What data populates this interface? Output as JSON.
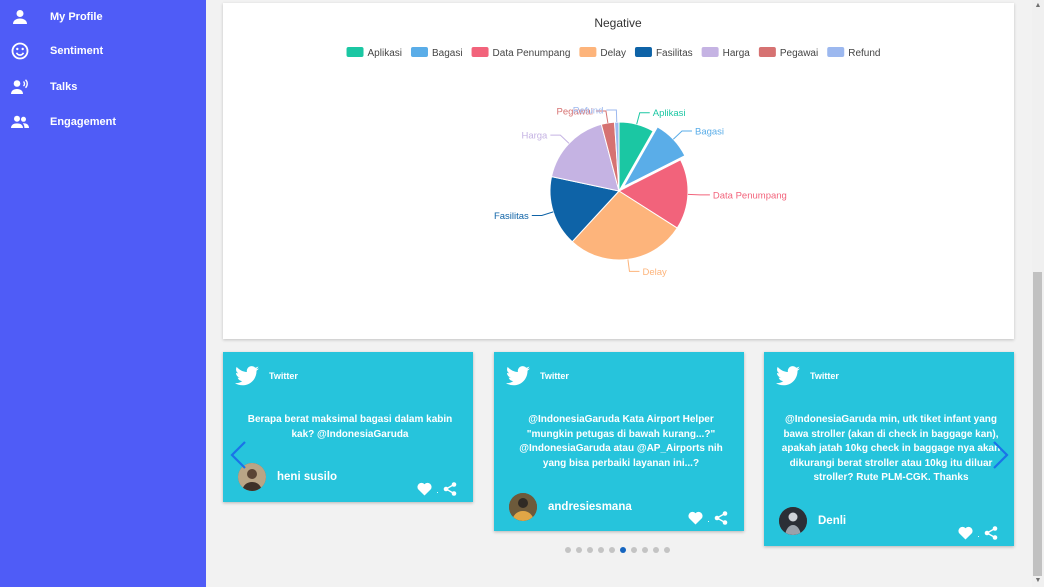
{
  "sidebar": {
    "items": [
      {
        "label": "My Profile",
        "icon": "person-icon"
      },
      {
        "label": "Sentiment",
        "icon": "smiley-icon"
      },
      {
        "label": "Talks",
        "icon": "talks-icon"
      },
      {
        "label": "Engagement",
        "icon": "group-icon"
      }
    ]
  },
  "chart_data": {
    "type": "pie",
    "title": "Negative",
    "legend_position": "top",
    "categories": [
      "Aplikasi",
      "Bagasi",
      "Data Penumpang",
      "Delay",
      "Fasilitas",
      "Harga",
      "Pegawai",
      "Refund"
    ],
    "values": [
      8,
      9,
      16,
      27,
      16,
      17,
      3,
      1
    ],
    "colors": [
      "#1bc7a3",
      "#5aade8",
      "#f2637b",
      "#fdb47b",
      "#0e63a7",
      "#c5b3e3",
      "#d67272",
      "#9cb8ef"
    ],
    "highlighted": "Bagasi"
  },
  "tweets": [
    {
      "source": "Twitter",
      "text": "Berapa berat maksimal bagasi dalam kabin kak? @IndonesiaGaruda",
      "user": "heni susilo"
    },
    {
      "source": "Twitter",
      "text": "@IndonesiaGaruda Kata Airport Helper \"mungkin petugas di bawah kurang...?\" @IndonesiaGaruda atau @AP_Airports nih yang bisa perbaiki layanan ini...?",
      "user": "andresiesmana"
    },
    {
      "source": "Twitter",
      "text": "@IndonesiaGaruda min, utk tiket infant yang bawa stroller (akan di check in baggage kan), apakah jatah 10kg check in baggage nya akan dikurangi berat stroller atau 10kg itu diluar stroller? Rute PLM-CGK. Thanks",
      "user": "Denli"
    }
  ],
  "carousel": {
    "total_dots": 10,
    "active_dot": 6
  },
  "icons": {
    "tweet": "twitter-bird-icon",
    "like": "heart-icon",
    "share": "share-icon",
    "prev": "chevron-left-icon",
    "next": "chevron-right-icon"
  }
}
